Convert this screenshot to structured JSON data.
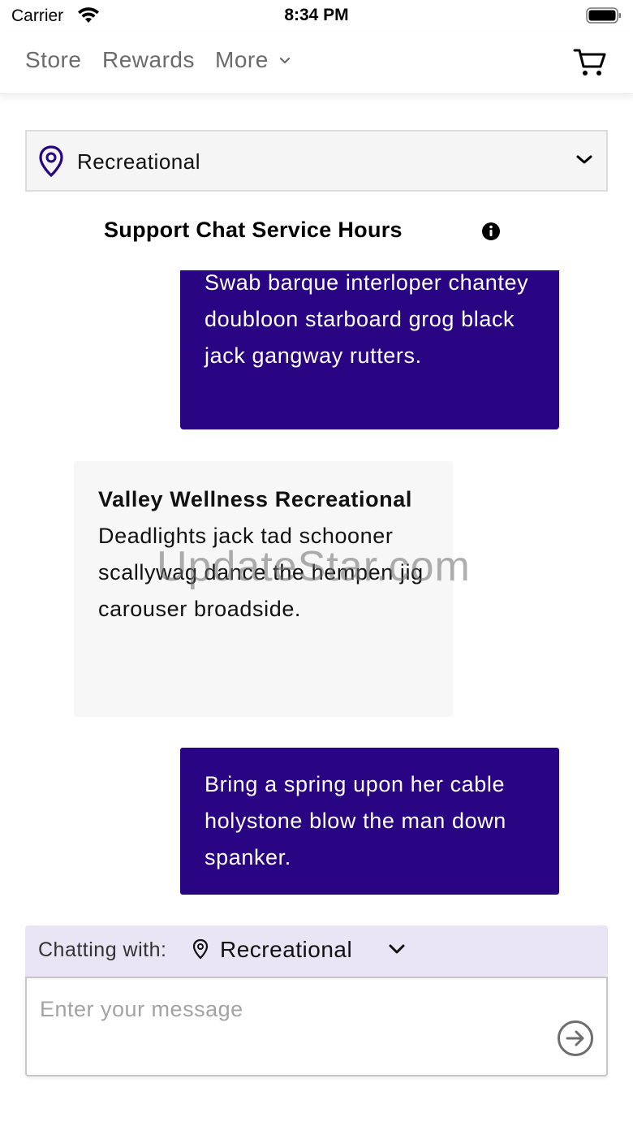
{
  "status_bar": {
    "carrier": "Carrier",
    "time": "8:34 PM"
  },
  "nav": {
    "store": "Store",
    "rewards": "Rewards",
    "more": "More"
  },
  "location_select": {
    "value": "Recreational"
  },
  "service_hours": {
    "title": "Support Chat Service Hours"
  },
  "messages": [
    {
      "direction": "outgoing",
      "text": "Swab barque interloper chantey doubloon starboard grog black jack gangway rutters."
    },
    {
      "direction": "incoming",
      "sender": "Valley Wellness Recreational",
      "text": "Deadlights jack tad schooner scallywag dance the hempen jig carouser broadside."
    },
    {
      "direction": "outgoing",
      "text": "Bring a spring upon her cable holystone blow the man down spanker."
    }
  ],
  "watermark": "UpdateStar.com",
  "chat_footer": {
    "chatting_with_label": "Chatting with:",
    "chatting_with_value": "Recreational",
    "input_placeholder": "Enter your message",
    "input_value": ""
  },
  "colors": {
    "accent": "#2a0583",
    "incoming_bubble": "#f7f7f7",
    "chatting_bar": "#e9e5f5",
    "nav_text": "#6b6b6b"
  },
  "icons": {
    "wifi": "wifi-icon",
    "battery": "battery-icon",
    "cart": "cart-icon",
    "location": "map-pin-icon",
    "chevron": "chevron-down-icon",
    "info": "info-icon",
    "send": "arrow-right-circle-icon"
  }
}
